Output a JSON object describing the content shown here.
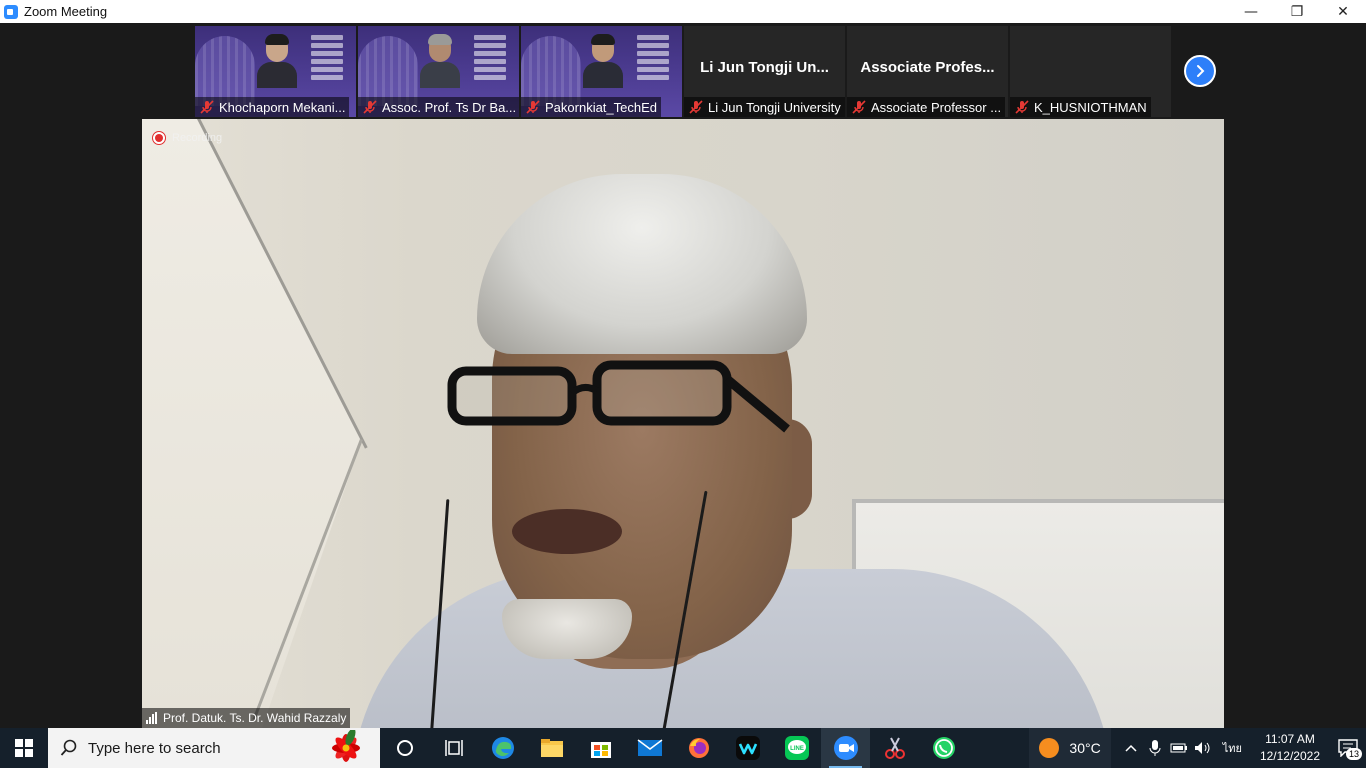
{
  "window": {
    "title": "Zoom Meeting",
    "minimize": "—",
    "restore": "❐",
    "close": "✕"
  },
  "thumbnails": [
    {
      "name": "Khochaporn Mekani...",
      "video": true
    },
    {
      "name": "Assoc. Prof. Ts Dr Ba...",
      "video": true
    },
    {
      "name": "Pakornkiat_TechEd",
      "video": true
    },
    {
      "name": "Li Jun Tongji University",
      "display_name": "Li Jun Tongji Un...",
      "video": false
    },
    {
      "name": "Associate Professor ...",
      "display_name": "Associate Profes...",
      "video": false
    },
    {
      "name": "K_HUSNIOTHMAN",
      "video": false
    }
  ],
  "main": {
    "recording_label": "Recording",
    "speaker_name": "Prof. Datuk. Ts. Dr. Wahid Razzaly"
  },
  "taskbar": {
    "search_placeholder": "Type here to search",
    "weather": "30°C",
    "language": "ไทย",
    "time": "11:07 AM",
    "date": "12/12/2022",
    "notification_count": "13"
  }
}
